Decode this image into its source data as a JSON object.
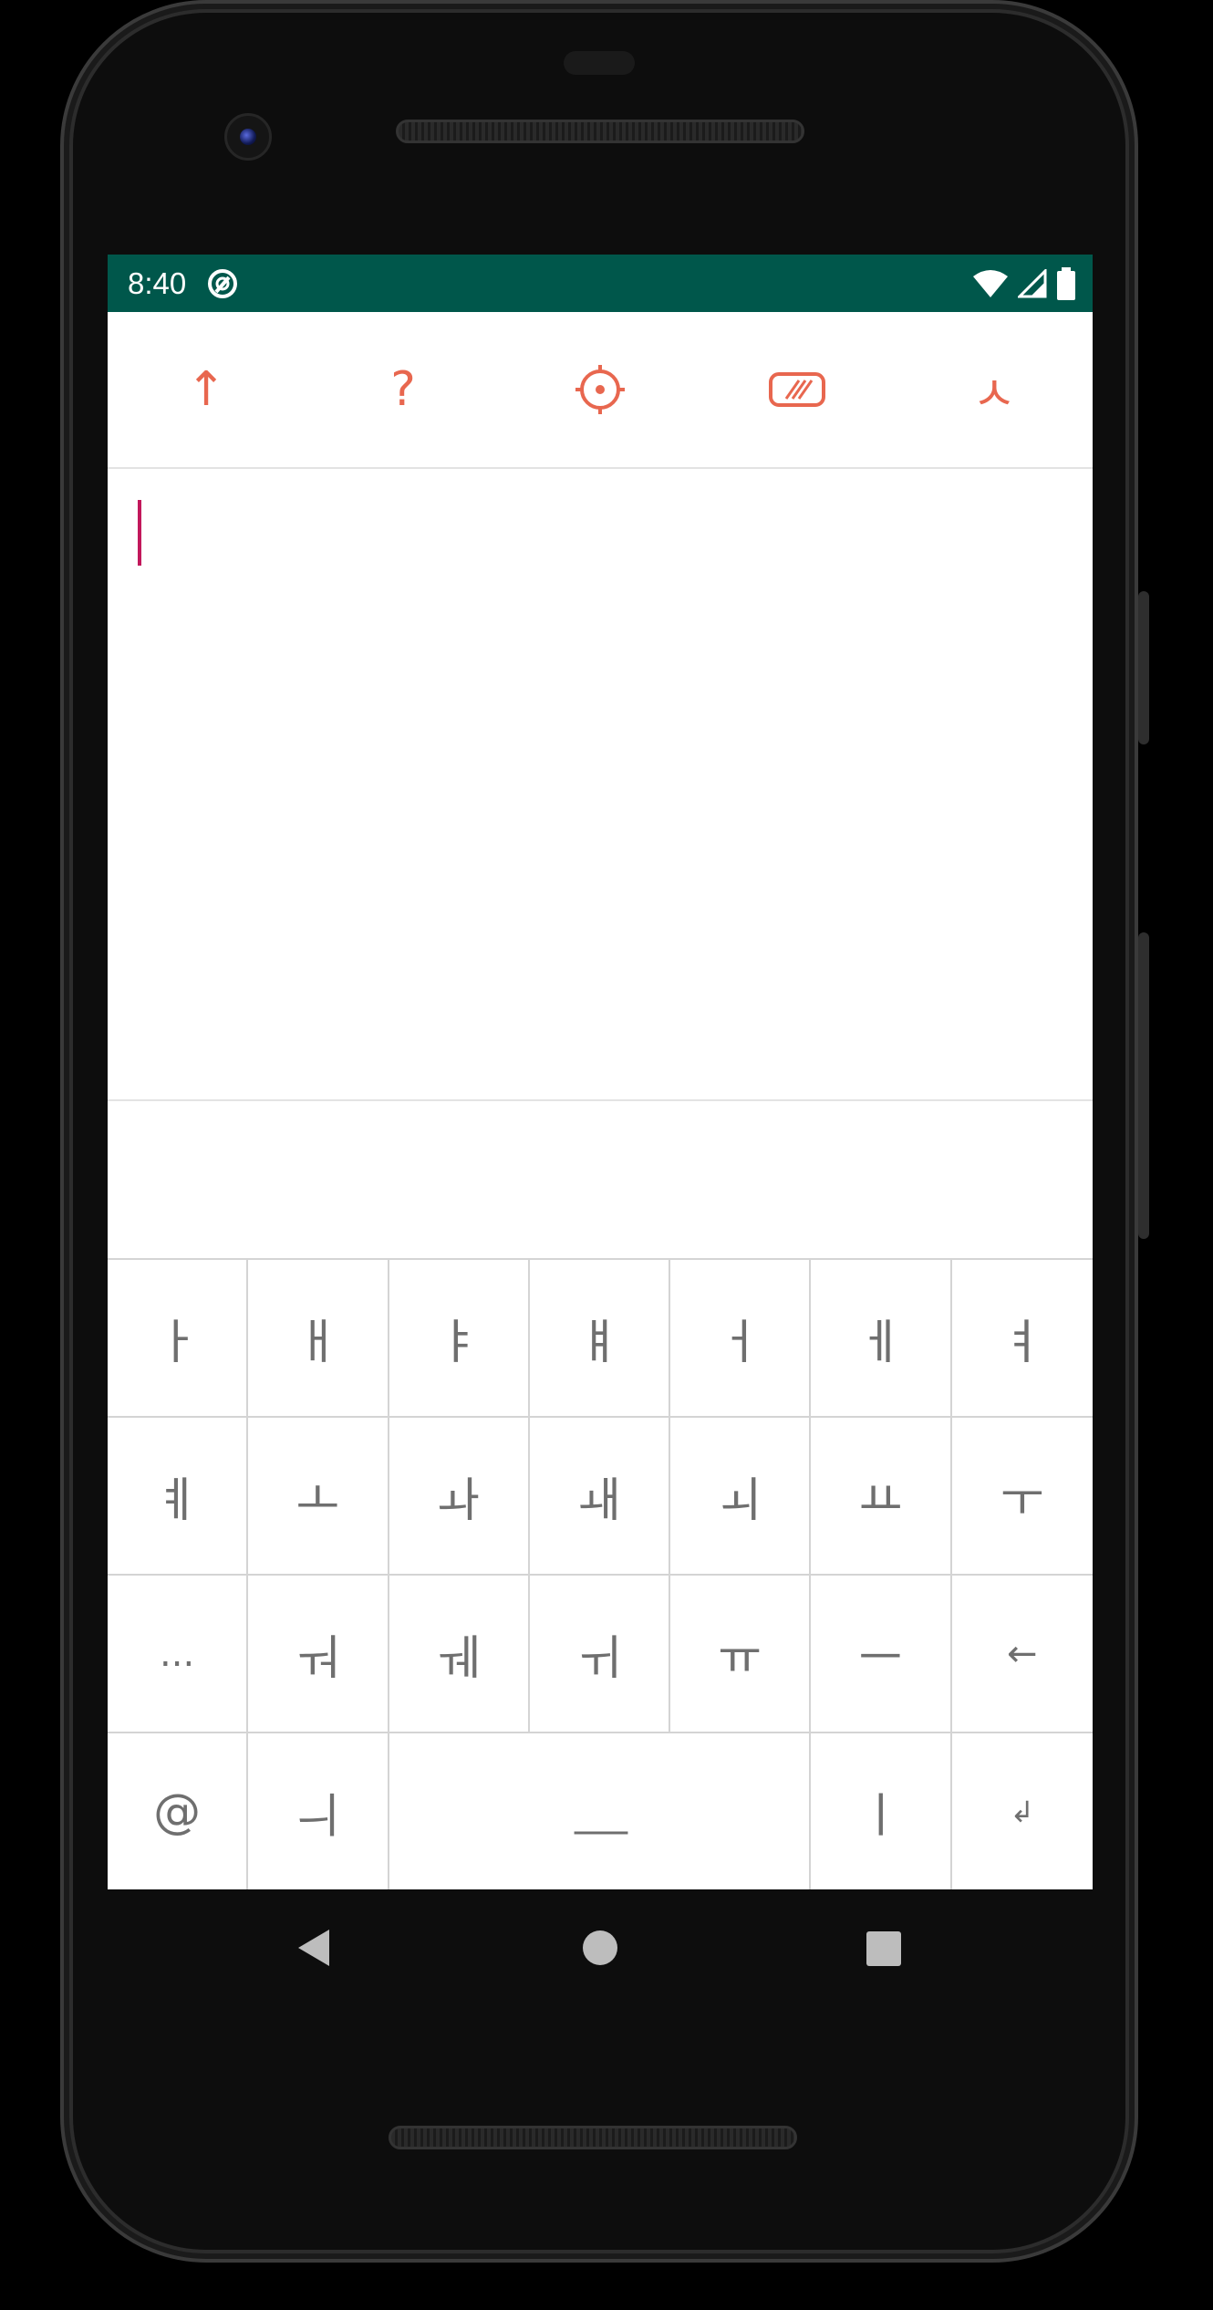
{
  "status_bar": {
    "time": "8:40",
    "icons": [
      "app-notification-icon",
      "wifi-icon",
      "signal-icon",
      "battery-icon"
    ]
  },
  "toolbar": {
    "buttons": [
      {
        "name": "shift-arrow",
        "label": "↑"
      },
      {
        "name": "help",
        "label": "?"
      },
      {
        "name": "settings",
        "icon": "gear-icon"
      },
      {
        "name": "keyboard-layout",
        "icon": "keyboard-toggle-icon"
      },
      {
        "name": "consonant-mode",
        "label": "ㅅ"
      }
    ],
    "accent_color": "#e8674f"
  },
  "editor": {
    "value": "",
    "caret_color": "#c2185b"
  },
  "keyboard": {
    "rows": [
      [
        "ㅏ",
        "ㅐ",
        "ㅑ",
        "ㅒ",
        "ㅓ",
        "ㅔ",
        "ㅕ"
      ],
      [
        "ㅖ",
        "ㅗ",
        "ㅘ",
        "ㅙ",
        "ㅚ",
        "ㅛ",
        "ㅜ"
      ],
      [
        "...",
        "ㅝ",
        "ㅞ",
        "ㅟ",
        "ㅠ",
        "ㅡ",
        "←"
      ],
      [
        "@",
        "ㅢ",
        "___",
        "ㅣ",
        "↲"
      ]
    ]
  },
  "status_bar_color": "#00574b"
}
